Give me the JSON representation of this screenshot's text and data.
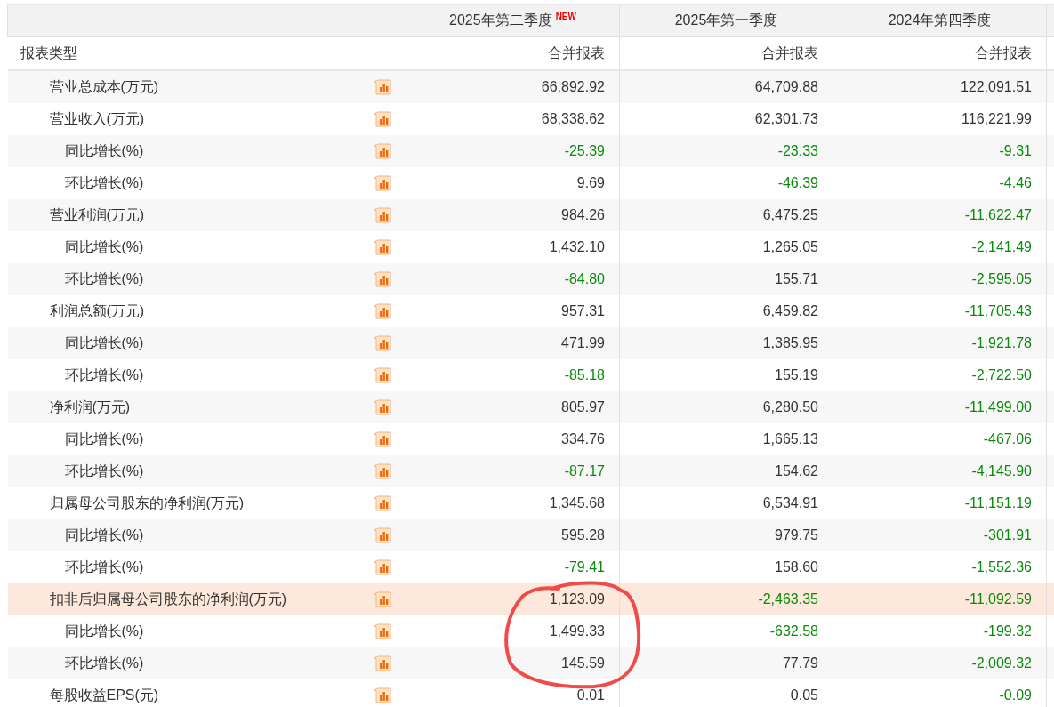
{
  "columns": [
    {
      "label": "2025年第二季度",
      "badge": "NEW"
    },
    {
      "label": "2025年第一季度"
    },
    {
      "label": "2024年第四季度"
    }
  ],
  "report_type": {
    "label": "报表类型",
    "values": [
      "合并报表",
      "合并报表",
      "合并报表"
    ]
  },
  "rows": [
    {
      "label": "营业总成本(万元)",
      "highlighted": false,
      "values": [
        {
          "text": "66,892.92",
          "down": false
        },
        {
          "text": "64,709.88",
          "down": false
        },
        {
          "text": "122,091.51",
          "down": false
        }
      ]
    },
    {
      "label": "营业收入(万元)",
      "highlighted": false,
      "values": [
        {
          "text": "68,338.62",
          "down": false
        },
        {
          "text": "62,301.73",
          "down": false
        },
        {
          "text": "116,221.99",
          "down": false
        }
      ],
      "children": [
        {
          "label": "同比增长(%)",
          "highlighted": false,
          "values": [
            {
              "text": "-25.39",
              "down": true
            },
            {
              "text": "-23.33",
              "down": true
            },
            {
              "text": "-9.31",
              "down": true
            }
          ]
        },
        {
          "label": "环比增长(%)",
          "highlighted": false,
          "values": [
            {
              "text": "9.69",
              "down": false
            },
            {
              "text": "-46.39",
              "down": true
            },
            {
              "text": "-4.46",
              "down": true
            }
          ]
        }
      ]
    },
    {
      "label": "营业利润(万元)",
      "highlighted": false,
      "values": [
        {
          "text": "984.26",
          "down": false
        },
        {
          "text": "6,475.25",
          "down": false
        },
        {
          "text": "-11,622.47",
          "down": true
        }
      ],
      "children": [
        {
          "label": "同比增长(%)",
          "highlighted": false,
          "values": [
            {
              "text": "1,432.10",
              "down": false
            },
            {
              "text": "1,265.05",
              "down": false
            },
            {
              "text": "-2,141.49",
              "down": true
            }
          ]
        },
        {
          "label": "环比增长(%)",
          "highlighted": false,
          "values": [
            {
              "text": "-84.80",
              "down": true
            },
            {
              "text": "155.71",
              "down": false
            },
            {
              "text": "-2,595.05",
              "down": true
            }
          ]
        }
      ]
    },
    {
      "label": "利润总额(万元)",
      "highlighted": false,
      "values": [
        {
          "text": "957.31",
          "down": false
        },
        {
          "text": "6,459.82",
          "down": false
        },
        {
          "text": "-11,705.43",
          "down": true
        }
      ],
      "children": [
        {
          "label": "同比增长(%)",
          "highlighted": false,
          "values": [
            {
              "text": "471.99",
              "down": false
            },
            {
              "text": "1,385.95",
              "down": false
            },
            {
              "text": "-1,921.78",
              "down": true
            }
          ]
        },
        {
          "label": "环比增长(%)",
          "highlighted": false,
          "values": [
            {
              "text": "-85.18",
              "down": true
            },
            {
              "text": "155.19",
              "down": false
            },
            {
              "text": "-2,722.50",
              "down": true
            }
          ]
        }
      ]
    },
    {
      "label": "净利润(万元)",
      "highlighted": false,
      "values": [
        {
          "text": "805.97",
          "down": false
        },
        {
          "text": "6,280.50",
          "down": false
        },
        {
          "text": "-11,499.00",
          "down": true
        }
      ],
      "children": [
        {
          "label": "同比增长(%)",
          "highlighted": false,
          "values": [
            {
              "text": "334.76",
              "down": false
            },
            {
              "text": "1,665.13",
              "down": false
            },
            {
              "text": "-467.06",
              "down": true
            }
          ]
        },
        {
          "label": "环比增长(%)",
          "highlighted": false,
          "values": [
            {
              "text": "-87.17",
              "down": true
            },
            {
              "text": "154.62",
              "down": false
            },
            {
              "text": "-4,145.90",
              "down": true
            }
          ]
        }
      ]
    },
    {
      "label": "归属母公司股东的净利润(万元)",
      "highlighted": false,
      "values": [
        {
          "text": "1,345.68",
          "down": false
        },
        {
          "text": "6,534.91",
          "down": false
        },
        {
          "text": "-11,151.19",
          "down": true
        }
      ],
      "children": [
        {
          "label": "同比增长(%)",
          "highlighted": false,
          "values": [
            {
              "text": "595.28",
              "down": false
            },
            {
              "text": "979.75",
              "down": false
            },
            {
              "text": "-301.91",
              "down": true
            }
          ]
        },
        {
          "label": "环比增长(%)",
          "highlighted": false,
          "values": [
            {
              "text": "-79.41",
              "down": true
            },
            {
              "text": "158.60",
              "down": false
            },
            {
              "text": "-1,552.36",
              "down": true
            }
          ]
        }
      ]
    },
    {
      "label": "扣非后归属母公司股东的净利润(万元)",
      "highlighted": true,
      "values": [
        {
          "text": "1,123.09",
          "down": false
        },
        {
          "text": "-2,463.35",
          "down": true
        },
        {
          "text": "-11,092.59",
          "down": true
        }
      ],
      "children": [
        {
          "label": "同比增长(%)",
          "highlighted": false,
          "values": [
            {
              "text": "1,499.33",
              "down": false
            },
            {
              "text": "-632.58",
              "down": true
            },
            {
              "text": "-199.32",
              "down": true
            }
          ]
        },
        {
          "label": "环比增长(%)",
          "highlighted": false,
          "values": [
            {
              "text": "145.59",
              "down": false
            },
            {
              "text": "77.79",
              "down": false
            },
            {
              "text": "-2,009.32",
              "down": true
            }
          ]
        }
      ]
    },
    {
      "label": "每股收益EPS(元)",
      "highlighted": false,
      "values": [
        {
          "text": "0.01",
          "down": false
        },
        {
          "text": "0.05",
          "down": false
        },
        {
          "text": "-0.09",
          "down": true
        }
      ]
    }
  ]
}
